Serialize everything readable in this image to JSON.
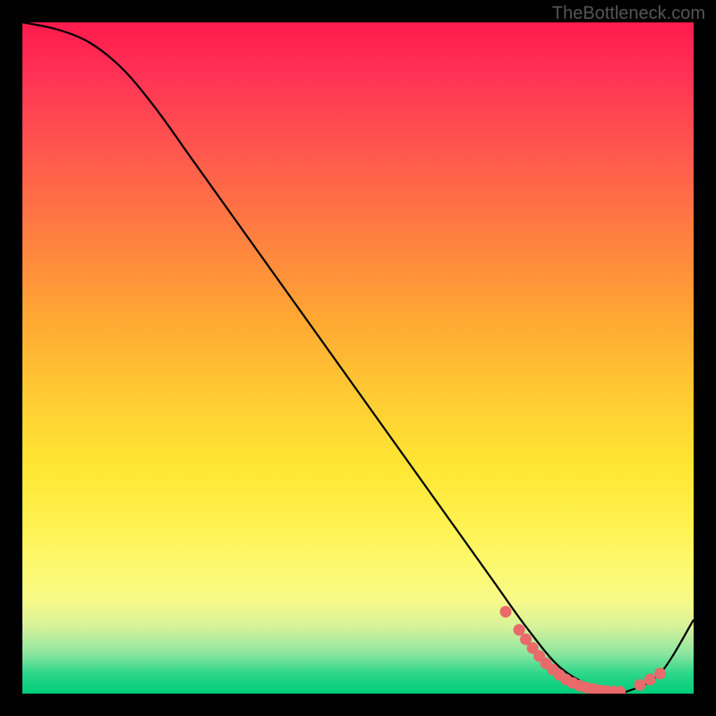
{
  "watermark": "TheBottleneck.com",
  "chart_data": {
    "type": "line",
    "title": "",
    "xlabel": "",
    "ylabel": "",
    "xlim": [
      0,
      100
    ],
    "ylim": [
      0,
      100
    ],
    "series": [
      {
        "name": "bottleneck-curve",
        "x": [
          0,
          5,
          10,
          15,
          20,
          25,
          30,
          35,
          40,
          45,
          50,
          55,
          60,
          65,
          70,
          75,
          80,
          85,
          88,
          90,
          95,
          100
        ],
        "values": [
          100,
          99,
          97,
          93,
          87,
          80,
          73,
          66,
          59,
          52,
          45,
          38,
          31,
          24,
          17,
          10,
          4,
          1,
          0.3,
          0.3,
          3,
          11
        ]
      }
    ],
    "markers": {
      "name": "highlight-dots",
      "x": [
        72,
        74,
        75,
        76,
        77,
        78,
        79,
        80,
        81,
        82,
        83,
        84,
        85,
        86,
        87,
        88,
        89,
        92,
        93.5,
        95
      ],
      "values": [
        12.2,
        9.5,
        8.1,
        6.8,
        5.6,
        4.5,
        3.6,
        2.8,
        2.1,
        1.6,
        1.2,
        0.9,
        0.7,
        0.5,
        0.4,
        0.3,
        0.3,
        1.3,
        2.1,
        3.0
      ]
    },
    "gradient_stops": [
      {
        "pos": 0,
        "color": "#ff1a4d"
      },
      {
        "pos": 50,
        "color": "#ffe633"
      },
      {
        "pos": 100,
        "color": "#00cc7a"
      }
    ]
  }
}
